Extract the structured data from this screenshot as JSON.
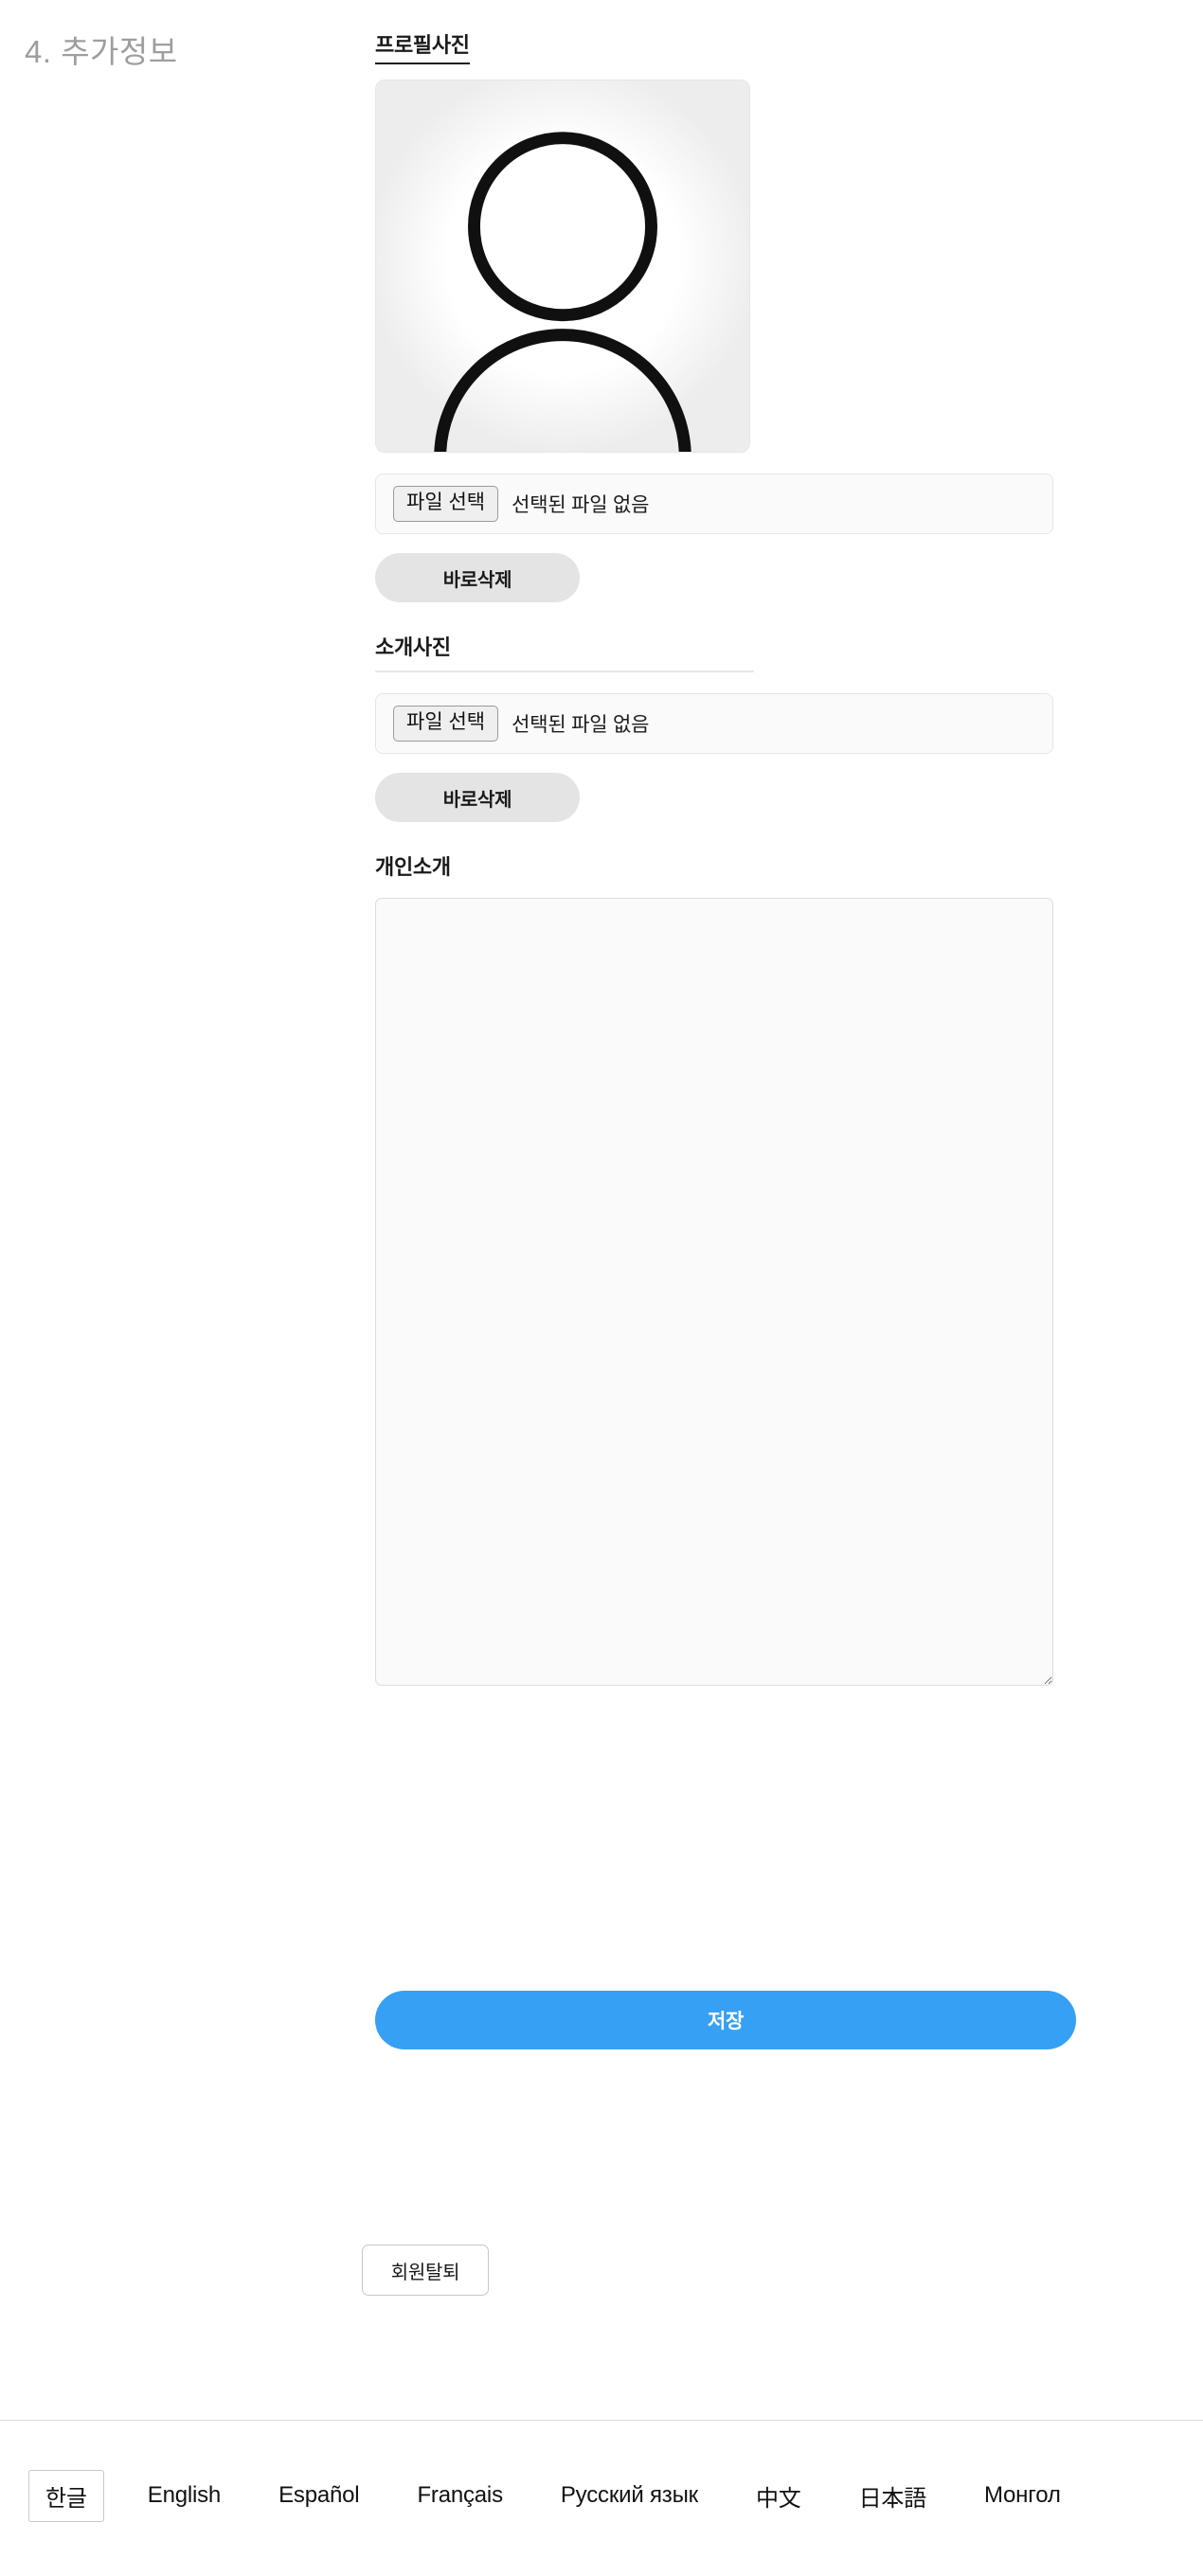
{
  "page": {
    "section_number_title": "4. 추가정보"
  },
  "profile_photo": {
    "label": "프로필사진",
    "preview_alt": "person-silhouette-avatar",
    "badge_icon": "globe-icon",
    "file_button_label": "파일 선택",
    "file_status": "선택된 파일 없음",
    "delete_label": "바로삭제"
  },
  "intro_photo": {
    "label": "소개사진",
    "file_button_label": "파일 선택",
    "file_status": "선택된 파일 없음",
    "delete_label": "바로삭제"
  },
  "personal_intro": {
    "label": "개인소개",
    "value": "",
    "placeholder": ""
  },
  "actions": {
    "save_label": "저장",
    "withdraw_label": "회원탈퇴"
  },
  "footer": {
    "languages": [
      {
        "label": "한글",
        "active": true
      },
      {
        "label": "English",
        "active": false
      },
      {
        "label": "Español",
        "active": false
      },
      {
        "label": "Français",
        "active": false
      },
      {
        "label": "Русский язык",
        "active": false
      },
      {
        "label": "中文",
        "active": false
      },
      {
        "label": "日本語",
        "active": false
      },
      {
        "label": "Монгол",
        "active": false
      }
    ]
  },
  "colors": {
    "save_blue": "#35a0f4",
    "title_gray": "#9e9e9e",
    "pill_gray": "#e4e4e4",
    "field_bg": "#fafafa",
    "divider": "#dedede"
  }
}
